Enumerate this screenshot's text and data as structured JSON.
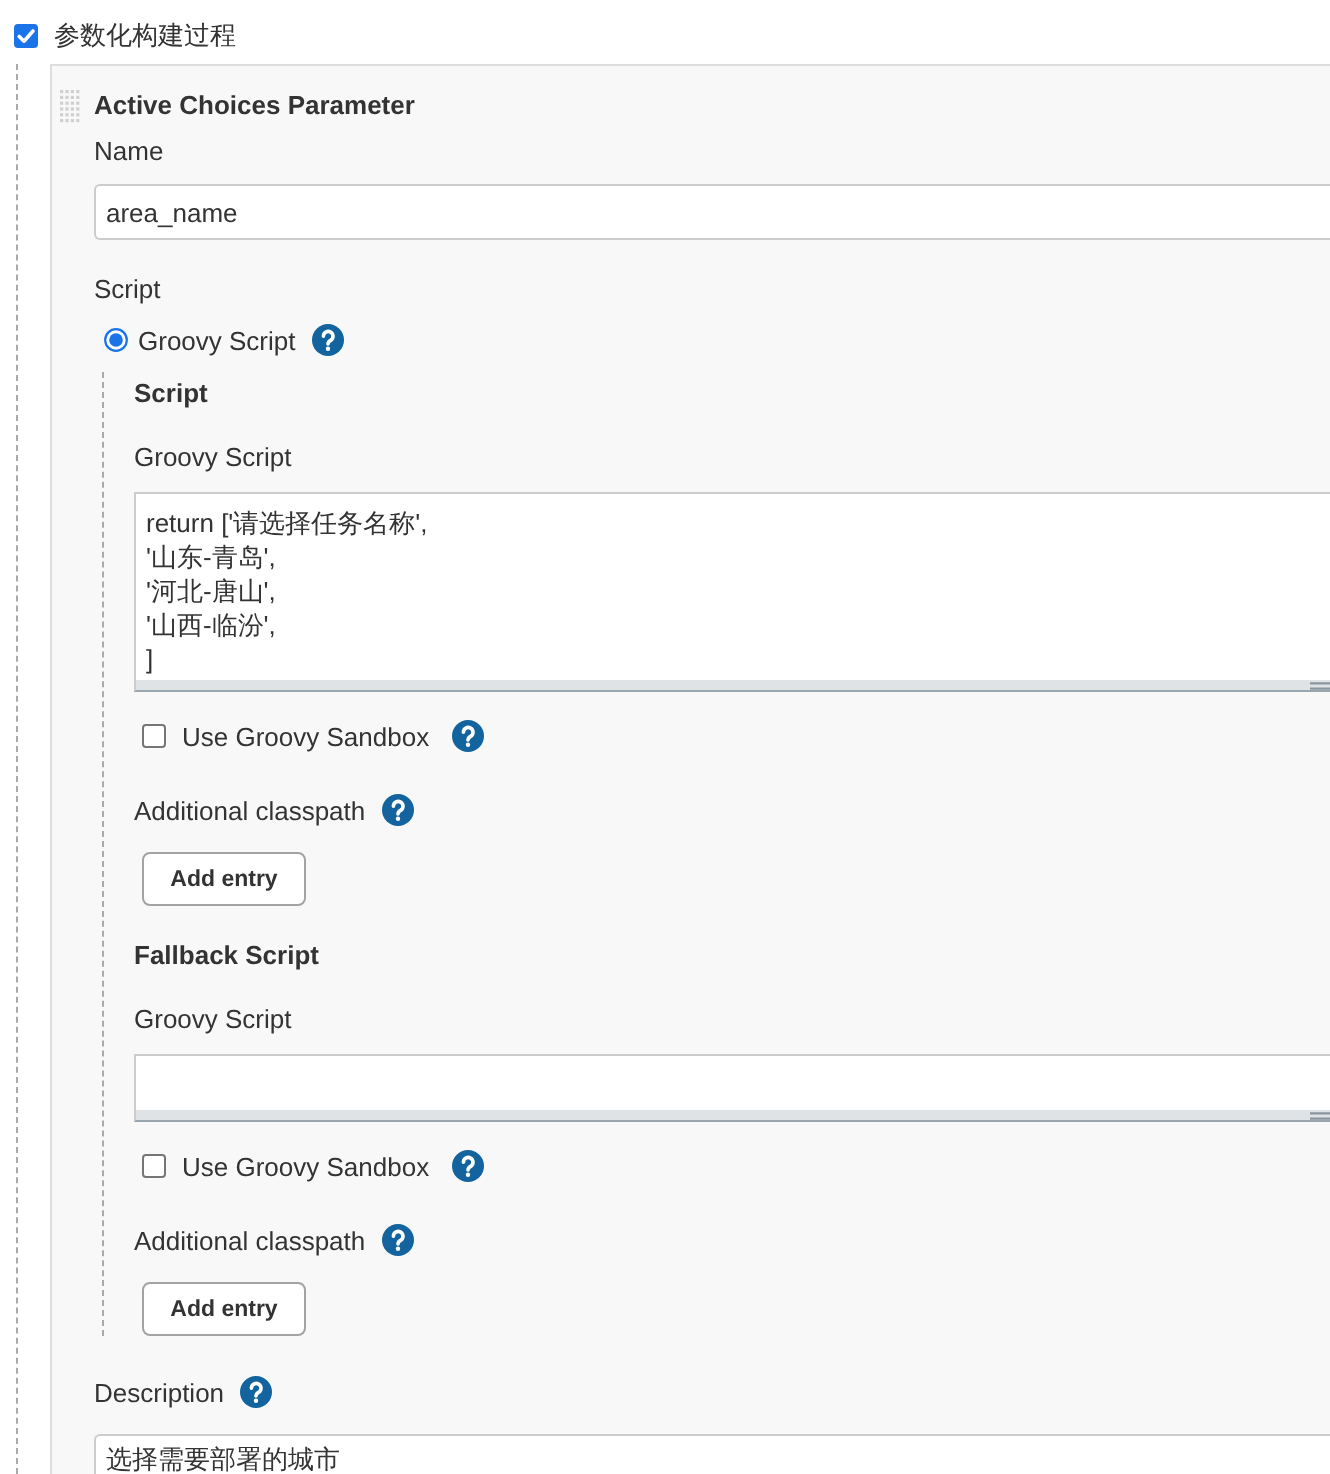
{
  "build_option": {
    "label": "参数化构建过程",
    "checked": true
  },
  "parameter": {
    "title": "Active Choices Parameter",
    "name": {
      "label": "Name",
      "value": "area_name"
    },
    "script_label": "Script",
    "script_types": [
      {
        "label": "Groovy Script",
        "selected": true
      }
    ],
    "sections": [
      {
        "heading": "Script",
        "field_label": "Groovy Script",
        "value": "return ['请选择任务名称',\n'山东-青岛',\n'河北-唐山',\n'山西-临汾',\n]",
        "sandbox": {
          "label": "Use Groovy Sandbox",
          "checked": false
        },
        "classpath_label": "Additional classpath",
        "button": "Add entry"
      },
      {
        "heading": "Fallback Script",
        "field_label": "Groovy Script",
        "sandbox": {
          "label": "Use Groovy Sandbox",
          "checked": false
        },
        "classpath_label": "Additional classpath",
        "button": "Add entry"
      }
    ],
    "description": {
      "label": "Description",
      "value": "选择需要部署的城市"
    }
  }
}
